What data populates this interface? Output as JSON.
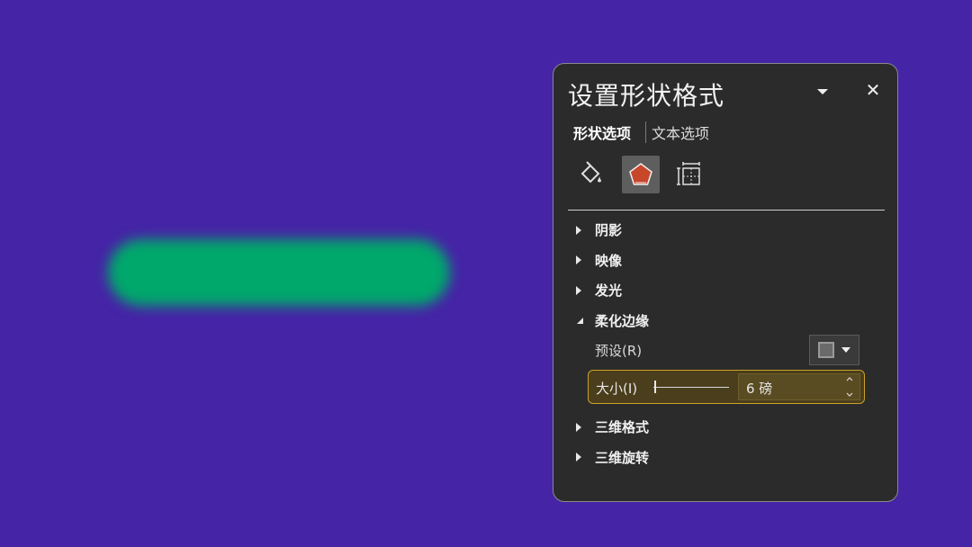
{
  "panel": {
    "title": "设置形状格式",
    "tabs": [
      {
        "label": "形状选项",
        "active": true
      },
      {
        "label": "文本选项",
        "active": false
      }
    ],
    "icons": [
      {
        "name": "fill-line-icon",
        "selected": false
      },
      {
        "name": "effects-pentagon-icon",
        "selected": true
      },
      {
        "name": "size-properties-icon",
        "selected": false
      }
    ],
    "sections_top": [
      {
        "label": "阴影",
        "expanded": false
      },
      {
        "label": "映像",
        "expanded": false
      },
      {
        "label": "发光",
        "expanded": false
      },
      {
        "label": "柔化边缘",
        "expanded": true
      }
    ],
    "soft_edges": {
      "preset_label": "预设(R)",
      "size_label": "大小(I)",
      "size_value": "6 磅"
    },
    "sections_bottom": [
      {
        "label": "三维格式",
        "expanded": false
      },
      {
        "label": "三维旋转",
        "expanded": false
      }
    ]
  },
  "colors": {
    "background": "#4524a6",
    "shape_fill": "#00a86b",
    "panel_bg": "#2b2b2b",
    "effects_icon": "#c8462a",
    "highlight_border": "#c9a227"
  }
}
